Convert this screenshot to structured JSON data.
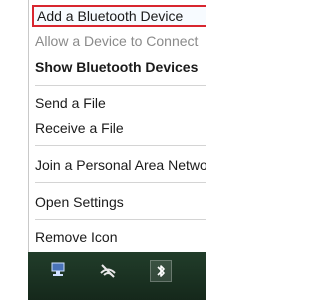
{
  "menu": {
    "items": [
      {
        "label": "Add a Bluetooth Device",
        "state": "highlighted"
      },
      {
        "label": "Allow a Device to Connect",
        "state": "disabled"
      },
      {
        "label": "Show Bluetooth Devices",
        "state": "bold"
      },
      {
        "label": "Send a File",
        "state": "normal"
      },
      {
        "label": "Receive a File",
        "state": "normal"
      },
      {
        "label": "Join a Personal Area Network",
        "state": "normal"
      },
      {
        "label": "Open Settings",
        "state": "normal"
      },
      {
        "label": "Remove Icon",
        "state": "normal"
      }
    ]
  },
  "tray": {
    "icons": [
      "network-tray-icon",
      "no-network-tray-icon",
      "bluetooth-tray-icon"
    ],
    "colors": {
      "background": "#1f3a24",
      "highlight_border": "#d8262f"
    }
  }
}
